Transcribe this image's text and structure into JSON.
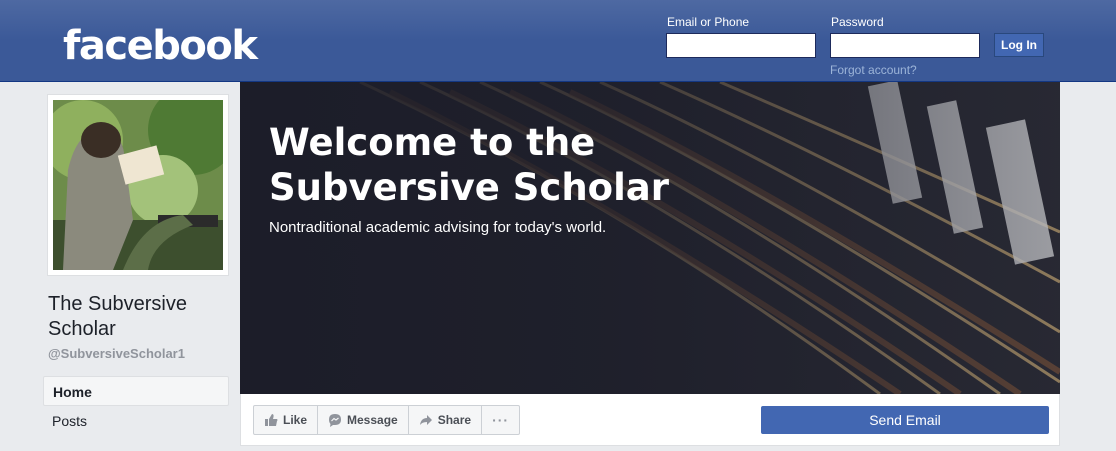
{
  "header": {
    "logo": "facebook",
    "email_label": "Email or Phone",
    "email_value": "",
    "password_label": "Password",
    "password_value": "",
    "login_label": "Log In",
    "forgot_label": "Forgot account?"
  },
  "profile": {
    "name": "The Subversive Scholar",
    "handle": "@SubversiveScholar1"
  },
  "nav": {
    "items": [
      {
        "label": "Home"
      },
      {
        "label": "Posts"
      }
    ]
  },
  "cover": {
    "title": "Welcome to the Subversive Scholar",
    "subtitle": "Nontraditional academic advising for today's world."
  },
  "actions": {
    "like_label": "Like",
    "message_label": "Message",
    "share_label": "Share",
    "more_label": "···",
    "send_email_label": "Send Email"
  },
  "colors": {
    "brand": "#3b5998",
    "button": "#4267b2"
  },
  "icons": {
    "like": "thumbs-up-icon",
    "message": "messenger-icon",
    "share": "share-arrow-icon",
    "more": "more-dots-icon"
  }
}
